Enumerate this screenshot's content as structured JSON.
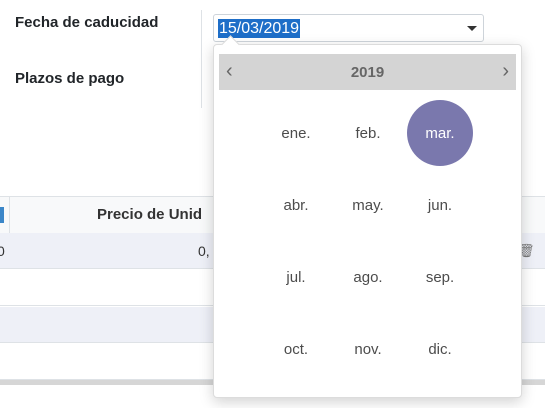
{
  "form": {
    "expiration_label": "Fecha de caducidad",
    "payment_terms_label": "Plazos de pago",
    "date_value": "15/03/2019"
  },
  "table": {
    "header_price": "Precio de Unid",
    "row1_left": "0",
    "row1_price": "0,"
  },
  "calendar": {
    "year": "2019",
    "prev_symbol": "‹",
    "next_symbol": "›",
    "months": [
      "ene.",
      "feb.",
      "mar.",
      "abr.",
      "may.",
      "jun.",
      "jul.",
      "ago.",
      "sep.",
      "oct.",
      "nov.",
      "dic."
    ],
    "selected_month": "mar.",
    "accent_color": "#7a78ad"
  }
}
